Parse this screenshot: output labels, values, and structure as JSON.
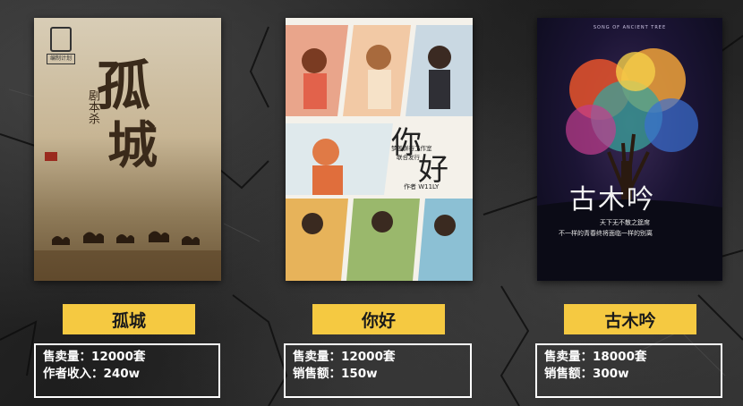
{
  "cards": [
    {
      "title": "孤城",
      "stats": [
        {
          "label": "售卖量：",
          "value": "12000套"
        },
        {
          "label": "作者收入：",
          "value": "240w"
        }
      ],
      "poster": {
        "title_chars": [
          "孤",
          "城"
        ],
        "subtitle": "剧本杀",
        "publisher_badge": "编制计划"
      }
    },
    {
      "title": "你好",
      "stats": [
        {
          "label": "售卖量：",
          "value": "12000套"
        },
        {
          "label": "销售额：",
          "value": "150w"
        }
      ],
      "poster": {
        "title_chars": [
          "你",
          "好"
        ],
        "line1": "梦盖饼行工作室",
        "line2": "联合发行",
        "author": "作者 W11LY"
      }
    },
    {
      "title": "古木吟",
      "stats": [
        {
          "label": "售卖量：",
          "value": "18000套"
        },
        {
          "label": "销售额：",
          "value": "300w"
        }
      ],
      "poster": {
        "top_text": "SONG OF ANCIENT TREE",
        "title_text": "古木吟",
        "line1": "天下无不散之筵席",
        "line2": "不一样的青春终将面临一样的别离"
      }
    }
  ]
}
